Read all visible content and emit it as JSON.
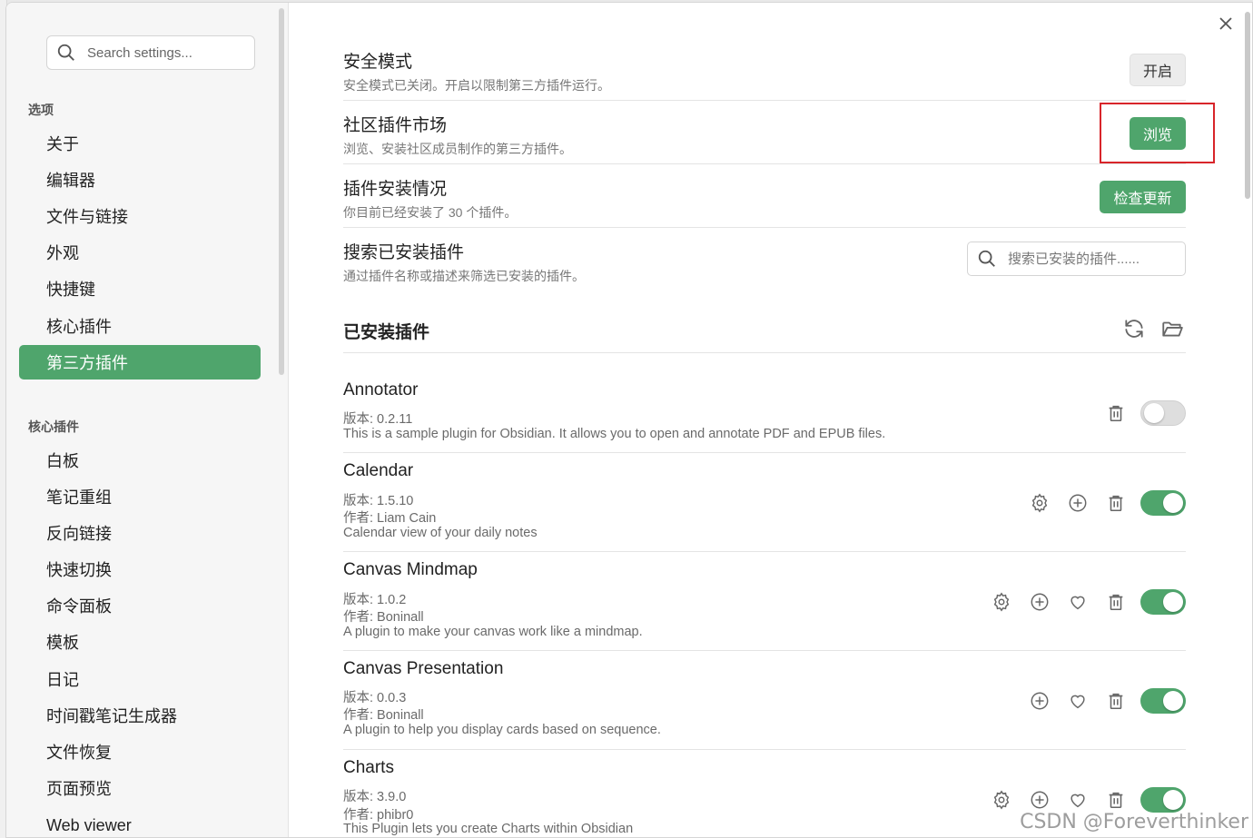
{
  "sidebar": {
    "search_placeholder": "Search settings...",
    "options_heading": "选项",
    "options": [
      {
        "label": "关于"
      },
      {
        "label": "编辑器"
      },
      {
        "label": "文件与链接"
      },
      {
        "label": "外观"
      },
      {
        "label": "快捷键"
      },
      {
        "label": "核心插件"
      },
      {
        "label": "第三方插件",
        "active": true
      }
    ],
    "core_heading": "核心插件",
    "core_plugins": [
      {
        "label": "白板"
      },
      {
        "label": "笔记重组"
      },
      {
        "label": "反向链接"
      },
      {
        "label": "快速切换"
      },
      {
        "label": "命令面板"
      },
      {
        "label": "模板"
      },
      {
        "label": "日记"
      },
      {
        "label": "时间戳笔记生成器"
      },
      {
        "label": "文件恢复"
      },
      {
        "label": "页面预览"
      },
      {
        "label": "Web viewer"
      }
    ]
  },
  "settings": {
    "safe_mode": {
      "name": "安全模式",
      "desc": "安全模式已关闭。开启以限制第三方插件运行。",
      "button": "开启"
    },
    "community": {
      "name": "社区插件市场",
      "desc": "浏览、安装社区成员制作的第三方插件。",
      "button": "浏览"
    },
    "install_status": {
      "name": "插件安装情况",
      "desc": "你目前已经安装了 30 个插件。",
      "button": "检查更新"
    },
    "search_installed": {
      "name": "搜索已安装插件",
      "desc": "通过插件名称或描述来筛选已安装的插件。",
      "placeholder": "搜索已安装的插件......"
    }
  },
  "installed": {
    "title": "已安装插件",
    "plugins": [
      {
        "name": "Annotator",
        "version": "版本: 0.2.11",
        "author": "",
        "desc": "This is a sample plugin for Obsidian. It allows you to open and annotate PDF and EPUB files.",
        "enabled": false
      },
      {
        "name": "Calendar",
        "version": "版本: 1.5.10",
        "author": "作者:  Liam Cain",
        "desc": "Calendar view of your daily notes",
        "enabled": true
      },
      {
        "name": "Canvas Mindmap",
        "version": "版本: 1.0.2",
        "author": "作者:  Boninall",
        "desc": "A plugin to make your canvas work like a mindmap.",
        "enabled": true
      },
      {
        "name": "Canvas Presentation",
        "version": "版本: 0.0.3",
        "author": "作者:  Boninall",
        "desc": "A plugin to help you display cards based on sequence.",
        "enabled": true
      },
      {
        "name": "Charts",
        "version": "版本: 3.9.0",
        "author": "作者:  phibr0",
        "desc": "This Plugin lets you create Charts within Obsidian",
        "enabled": true
      }
    ]
  },
  "watermark": "CSDN @Foreverthinker",
  "colors": {
    "accent": "#4fa56c",
    "highlight": "#d8252a"
  }
}
